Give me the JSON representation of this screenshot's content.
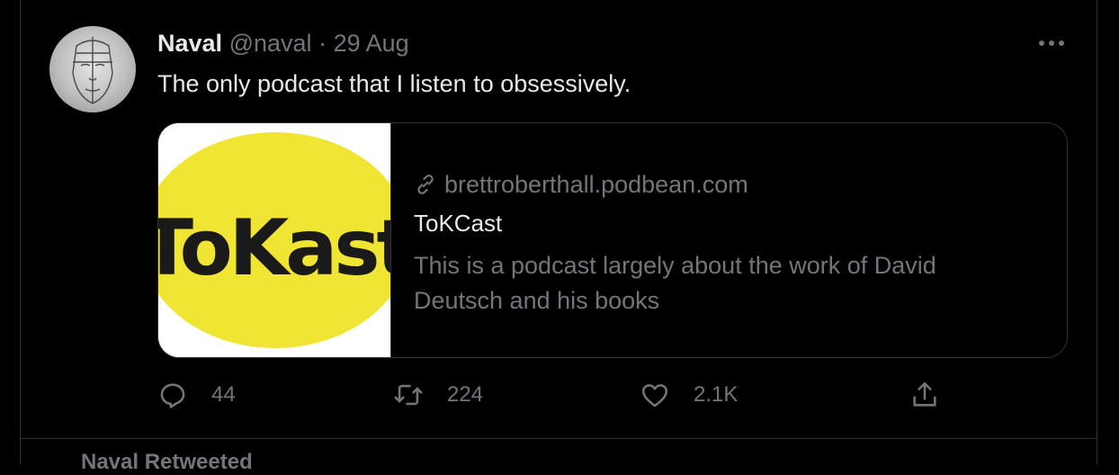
{
  "tweet": {
    "author": {
      "name": "Naval",
      "handle": "@naval"
    },
    "separator": "·",
    "date": "29 Aug",
    "text": "The only podcast that I listen to obsessively.",
    "more_icon": "more-horizontal-icon",
    "card": {
      "image_logo_text": "ToKast",
      "domain": "brettroberthall.podbean.com",
      "title": "ToKCast",
      "description": "This is a podcast largely about the work of David Deutsch and his books"
    },
    "actions": {
      "reply": {
        "icon": "reply-icon",
        "count": "44"
      },
      "retweet": {
        "icon": "retweet-icon",
        "count": "224"
      },
      "like": {
        "icon": "heart-icon",
        "count": "2.1K"
      },
      "share": {
        "icon": "share-icon"
      }
    }
  },
  "next_item": {
    "label": "Naval Retweeted"
  },
  "colors": {
    "background": "#000000",
    "text_primary": "#e7e9ea",
    "text_secondary": "#71767b",
    "border": "#2f3336",
    "card_logo_yellow": "#f0e533"
  }
}
